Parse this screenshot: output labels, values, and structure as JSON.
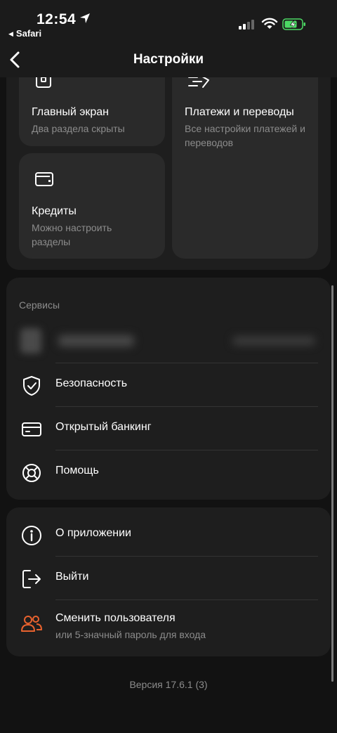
{
  "status_bar": {
    "time": "12:54",
    "back_app": "Safari"
  },
  "header": {
    "title": "Настройки"
  },
  "tiles": {
    "home": {
      "title": "Главный экран",
      "subtitle": "Два раздела скрыты",
      "icon": "phone-screen-icon"
    },
    "payments": {
      "title": "Платежи и переводы",
      "subtitle": "Все настройки платежей и переводов",
      "icon": "transfer-arrows-icon"
    },
    "credits": {
      "title": "Кредиты",
      "subtitle": "Можно настроить разделы",
      "icon": "wallet-icon"
    }
  },
  "services": {
    "label": "Сервисы",
    "items": [
      {
        "label": "Безопасность",
        "icon": "shield-check-icon"
      },
      {
        "label": "Открытый банкинг",
        "icon": "card-icon"
      },
      {
        "label": "Помощь",
        "icon": "lifebuoy-icon"
      }
    ]
  },
  "app_section": {
    "items": [
      {
        "label": "О приложении",
        "icon": "info-icon"
      },
      {
        "label": "Выйти",
        "icon": "logout-icon"
      }
    ],
    "switch_user": {
      "label": "Сменить пользователя",
      "subtitle": "или 5-значный пароль для входа",
      "icon": "users-icon",
      "accent_color": "#e8622e"
    }
  },
  "footer": {
    "version": "Версия 17.6.1 (3)"
  },
  "colors": {
    "background": "#121212",
    "card": "#1e1e1e",
    "tile": "#2a2a2a",
    "secondary_text": "#8c8c8c",
    "battery_green": "#4cd964"
  }
}
